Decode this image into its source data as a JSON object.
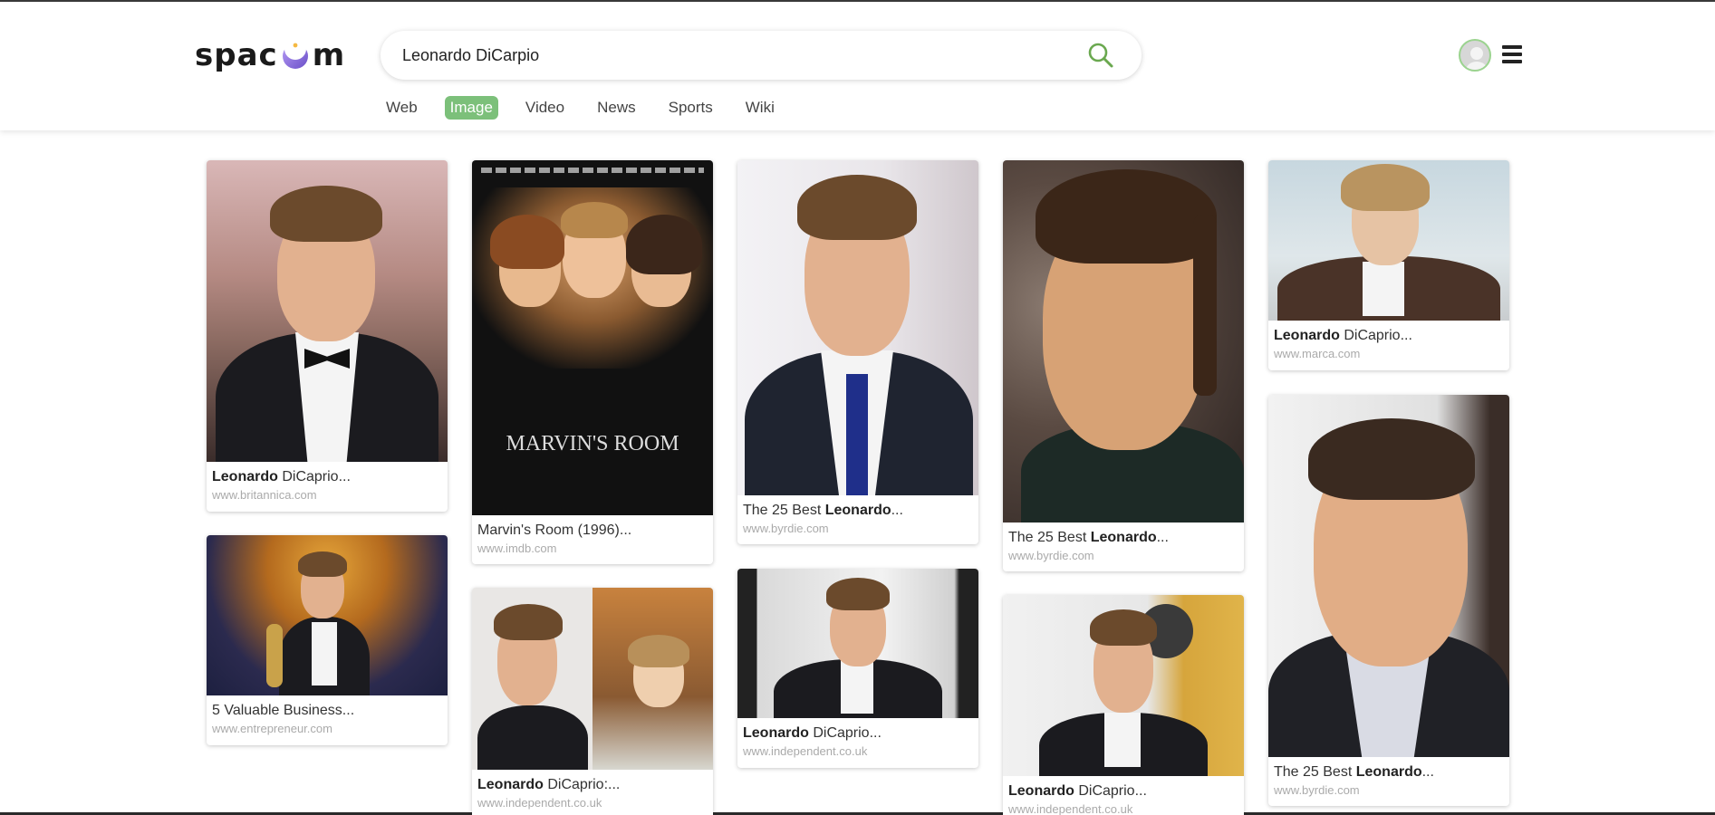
{
  "logo": {
    "text_left": "spac",
    "text_right": "m"
  },
  "search": {
    "value": "Leonardo DiCarpio"
  },
  "tabs": [
    {
      "label": "Web"
    },
    {
      "label": "Image"
    },
    {
      "label": "Video"
    },
    {
      "label": "News"
    },
    {
      "label": "Sports"
    },
    {
      "label": "Wiki"
    }
  ],
  "active_tab": "Image",
  "results": [
    {
      "title_bold": "Leonardo",
      "title_rest": " DiCaprio...",
      "source": "www.britannica.com"
    },
    {
      "title_pre": "Marvin's Room (1996)...",
      "source": "www.imdb.com",
      "poster_title": "MARVIN'S ROOM"
    },
    {
      "title_pre": "The 25 Best ",
      "title_bold": "Leonardo",
      "title_rest": "...",
      "source": "www.byrdie.com"
    },
    {
      "title_pre": "The 25 Best ",
      "title_bold": "Leonardo",
      "title_rest": "...",
      "source": "www.byrdie.com"
    },
    {
      "title_bold": "Leonardo",
      "title_rest": " DiCaprio...",
      "source": "www.marca.com"
    },
    {
      "title_pre": "5 Valuable Business...",
      "source": "www.entrepreneur.com"
    },
    {
      "title_bold": "Leonardo",
      "title_rest": " DiCaprio:...",
      "source": "www.independent.co.uk"
    },
    {
      "title_bold": "Leonardo",
      "title_rest": " DiCaprio...",
      "source": "www.independent.co.uk"
    },
    {
      "title_bold": "Leonardo",
      "title_rest": " DiCaprio...",
      "source": "www.independent.co.uk"
    },
    {
      "title_pre": "The 25 Best ",
      "title_bold": "Leonardo",
      "title_rest": "...",
      "source": "www.byrdie.com"
    }
  ],
  "colors": {
    "accent": "#7cc07a",
    "moon": "#8a6fd8",
    "search_icon": "#6aa84f"
  }
}
